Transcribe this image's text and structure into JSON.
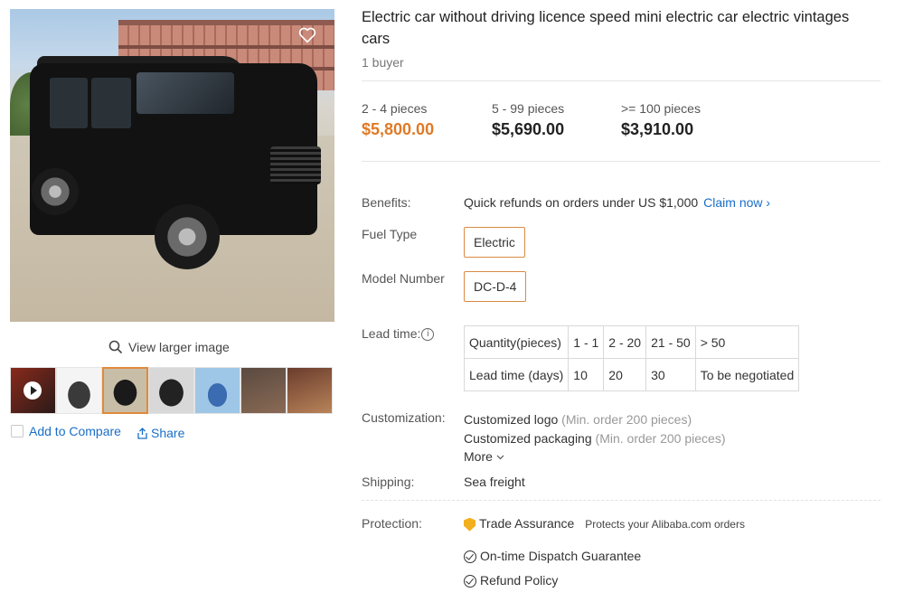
{
  "product": {
    "title": "Electric car without driving licence speed mini electric car electric vintages cars",
    "buyers": "1 buyer"
  },
  "gallery": {
    "view_larger": "View larger image",
    "thumbnails": [
      {
        "name": "video",
        "colors": [
          "#8a2a1c",
          "#2a1a18"
        ]
      },
      {
        "name": "white-car",
        "colors": [
          "#f4f4f4",
          "#3a3a3a"
        ]
      },
      {
        "name": "black-car-active",
        "colors": [
          "#c8bea8",
          "#1a1a1a"
        ]
      },
      {
        "name": "rear-view",
        "colors": [
          "#d8d8d8",
          "#222"
        ]
      },
      {
        "name": "blue-car",
        "colors": [
          "#9ec6e6",
          "#3b6bb0"
        ]
      },
      {
        "name": "interior",
        "colors": [
          "#5a4a40",
          "#8a6a55"
        ]
      },
      {
        "name": "seats",
        "colors": [
          "#6a3c2c",
          "#b9845a"
        ]
      }
    ],
    "add_to_compare": "Add to Compare",
    "share": "Share"
  },
  "pricing": [
    {
      "range": "2 - 4 pieces",
      "price": "$5,800.00"
    },
    {
      "range": "5 - 99 pieces",
      "price": "$5,690.00"
    },
    {
      "range": ">= 100 pieces",
      "price": "$3,910.00"
    }
  ],
  "details": {
    "benefits_label": "Benefits:",
    "benefits_text": "Quick refunds on orders under US $1,000",
    "claim_now": "Claim now ›",
    "fuel_label": "Fuel Type",
    "fuel_value": "Electric",
    "model_label": "Model Number",
    "model_value": "DC-D-4",
    "lead_label": "Lead time:",
    "lead_table": {
      "row1": [
        "Quantity(pieces)",
        "1 - 1",
        "2 - 20",
        "21 - 50",
        "> 50"
      ],
      "row2": [
        "Lead time (days)",
        "10",
        "20",
        "30",
        "To be negotiated"
      ]
    },
    "customization_label": "Customization:",
    "custom1_name": "Customized logo",
    "custom1_note": "(Min. order 200 pieces)",
    "custom2_name": "Customized packaging",
    "custom2_note": "(Min. order 200 pieces)",
    "more": "More",
    "shipping_label": "Shipping:",
    "shipping_value": "Sea freight",
    "protection_label": "Protection:",
    "trade_assurance": "Trade Assurance",
    "trade_assurance_note": "Protects your Alibaba.com orders",
    "dispatch": "On-time Dispatch Guarantee",
    "refund": "Refund Policy"
  },
  "colors": {
    "accent_price": "#e07a26",
    "link": "#1a6ec7",
    "chip_border": "#d98a44"
  }
}
